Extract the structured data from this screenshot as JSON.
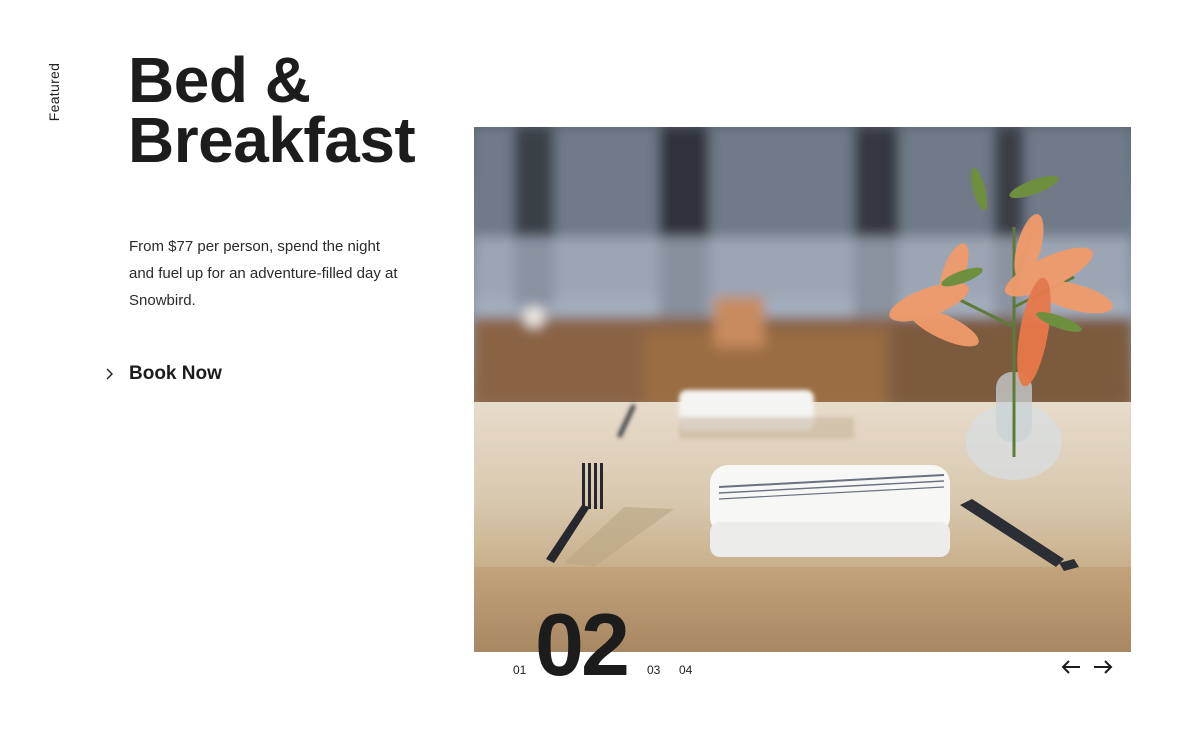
{
  "sidebar": {
    "label": "Featured"
  },
  "hero": {
    "title_line1": "Bed &",
    "title_line2": "Breakfast",
    "description": "From $77 per person, spend the night and fuel up for an adventure-filled day at Snowbird.",
    "cta_label": "Book Now"
  },
  "image": {
    "subject": "restaurant-table-setting-photo"
  },
  "slider": {
    "slides": [
      "01",
      "02",
      "03",
      "04"
    ],
    "current": "02"
  },
  "icons": {
    "cta": "chevron-right-icon",
    "prev": "arrow-left-icon",
    "next": "arrow-right-icon"
  }
}
